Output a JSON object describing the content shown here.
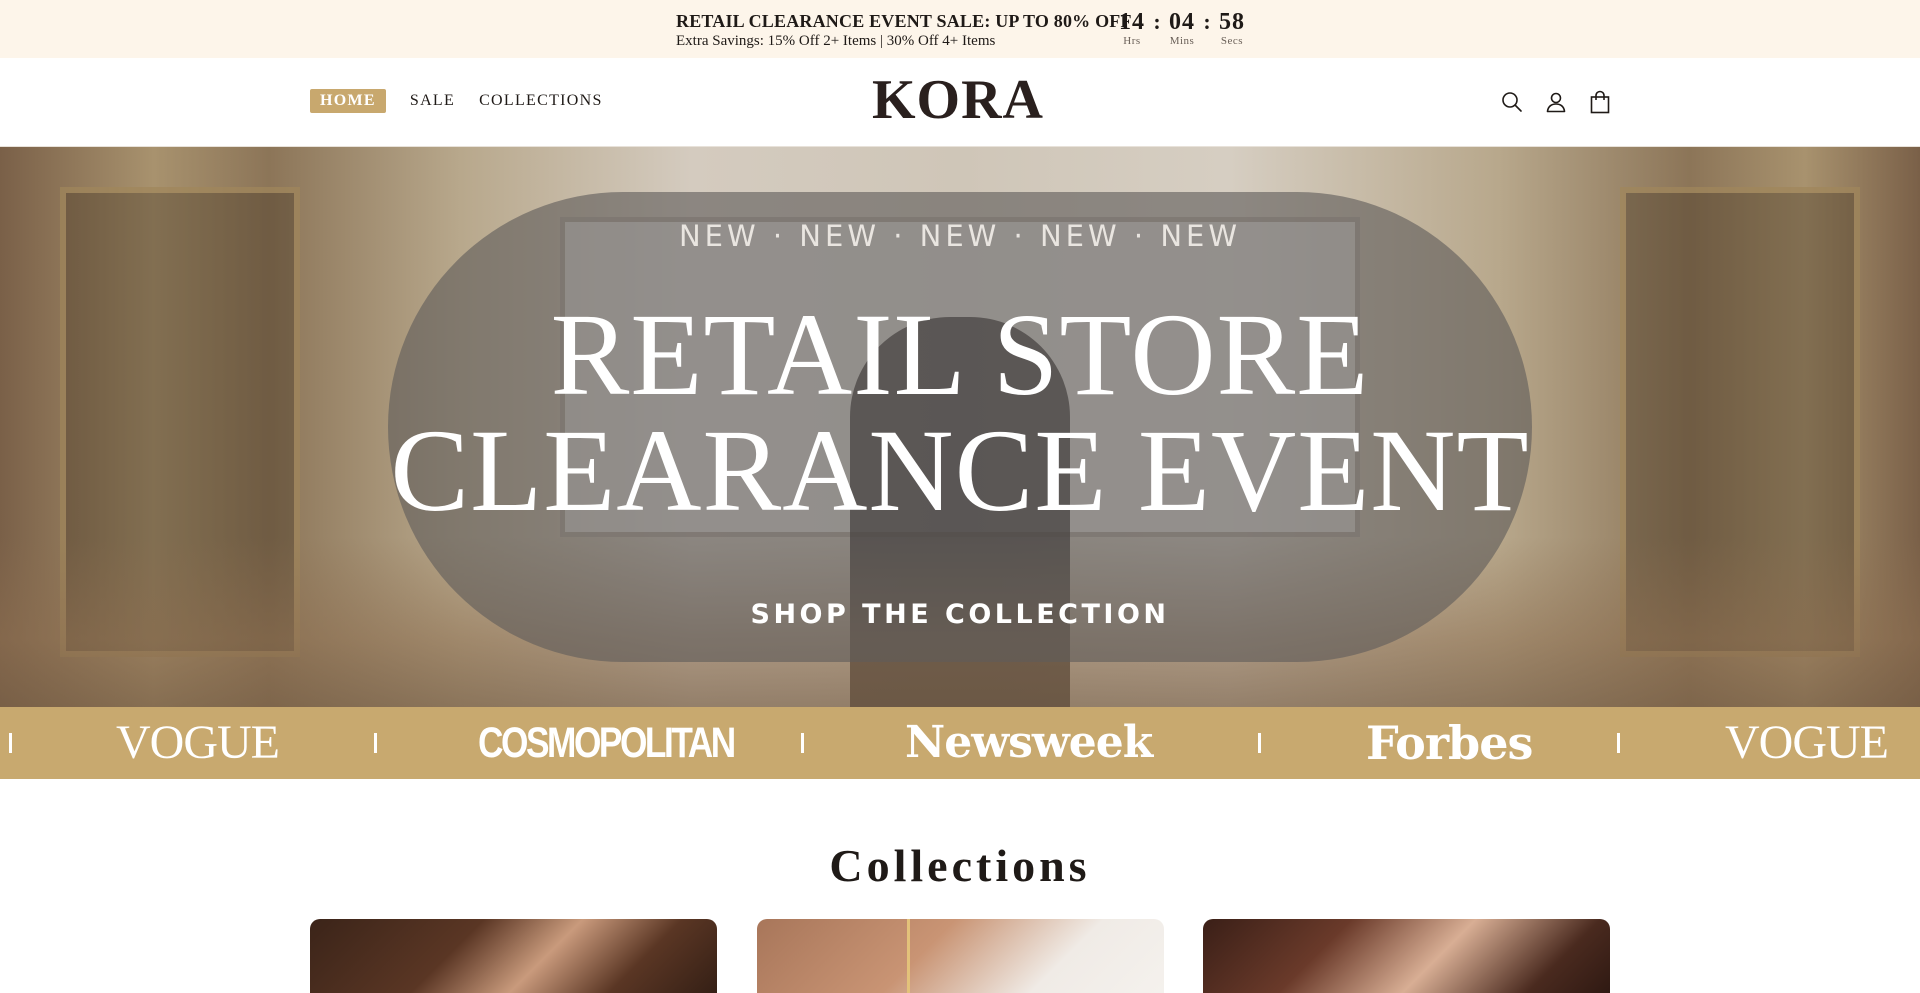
{
  "announcement": {
    "title": "RETAIL CLEARANCE EVENT SALE: UP TO 80% OFF",
    "subtitle": "Extra Savings: 15% Off 2+ Items | 30% Off 4+ Items",
    "timer": {
      "hours": "14",
      "hours_label": "Hrs",
      "minutes": "04",
      "minutes_label": "Mins",
      "seconds": "58",
      "seconds_label": "Secs",
      "separator": ":"
    }
  },
  "header": {
    "nav": [
      {
        "label": "HOME",
        "active": true
      },
      {
        "label": "SALE",
        "active": false
      },
      {
        "label": "COLLECTIONS",
        "active": false
      }
    ],
    "logo": "KORA",
    "icons": [
      "search-icon",
      "account-icon",
      "cart-icon"
    ],
    "accent_color": "#c8a86e"
  },
  "hero": {
    "eyebrow": "NEW · NEW · NEW · NEW · NEW",
    "title_line1": "RETAIL STORE",
    "title_line2": "CLEARANCE EVENT",
    "cta": "SHOP THE COLLECTION"
  },
  "press": {
    "background_color": "#c8a96f",
    "logos": [
      "VOGUE",
      "COSMOPOLITAN",
      "Newsweek",
      "Forbes",
      "VOGUE"
    ]
  },
  "collections": {
    "title": "Collections"
  }
}
